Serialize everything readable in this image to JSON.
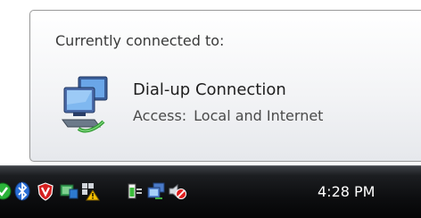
{
  "tooltip": {
    "header": "Currently connected to:",
    "connection_name": "Dial-up Connection",
    "access_label": "Access:",
    "access_value": "Local and Internet",
    "icon": "network-connection-icon"
  },
  "taskbar": {
    "clock": "4:28 PM",
    "tray_icons": [
      "green-check-icon",
      "bluetooth-icon",
      "antivirus-shield-icon",
      "network-monitor-icon",
      "security-warning-icon",
      "power-plug-icon",
      "network-connected-icon",
      "volume-muted-icon"
    ]
  },
  "colors": {
    "taskbar": "#0d0e10",
    "tooltip_border": "#9a9a9a",
    "clock_text": "#ffffff"
  }
}
